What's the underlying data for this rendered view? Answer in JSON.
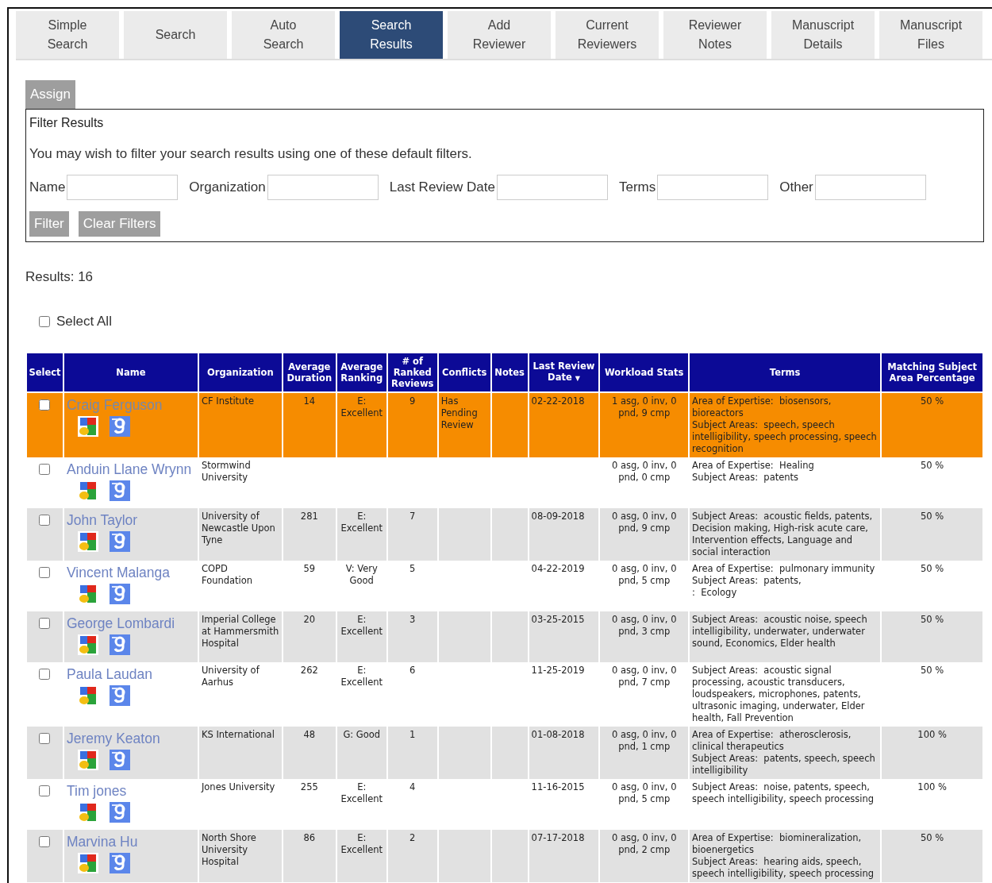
{
  "tabs": [
    {
      "label": "Simple\nSearch",
      "selected": false
    },
    {
      "label": "Search",
      "selected": false
    },
    {
      "label": "Auto\nSearch",
      "selected": false
    },
    {
      "label": "Search\nResults",
      "selected": true
    },
    {
      "label": "Add\nReviewer",
      "selected": false
    },
    {
      "label": "Current\nReviewers",
      "selected": false
    },
    {
      "label": "Reviewer\nNotes",
      "selected": false
    },
    {
      "label": "Manuscript\nDetails",
      "selected": false
    },
    {
      "label": "Manuscript\nFiles",
      "selected": false
    }
  ],
  "assign_button": "Assign",
  "filter": {
    "title": "Filter Results",
    "description": "You may wish to filter your search results using one of these default filters.",
    "fields": [
      {
        "label": "Name"
      },
      {
        "label": "Organization"
      },
      {
        "label": "Last Review Date"
      },
      {
        "label": "Terms"
      },
      {
        "label": "Other"
      }
    ],
    "buttons": [
      "Filter",
      "Clear Filters"
    ]
  },
  "results_count": "Results: 16",
  "select_all": {
    "label": "Select All",
    "checked": false
  },
  "table": {
    "columns": [
      {
        "label": "Select"
      },
      {
        "label": "Name"
      },
      {
        "label": "Organization"
      },
      {
        "label": "Average Duration"
      },
      {
        "label": "Average Ranking"
      },
      {
        "label": "# of Ranked Reviews"
      },
      {
        "label": "Conflicts"
      },
      {
        "label": "Notes"
      },
      {
        "label": "Last Review Date",
        "sort_indicator": "▼"
      },
      {
        "label": "Workload Stats"
      },
      {
        "label": "Terms"
      },
      {
        "label": "Matching Subject Area Percentage"
      }
    ],
    "rows": [
      {
        "checked": false,
        "highlighted": true,
        "name": "Craig Ferguson",
        "organization": "CF Institute",
        "duration": "14",
        "ranking": "E: Excellent",
        "ranked_reviews": "9",
        "conflicts": "Has Pending Review",
        "last_review": "02-22-2018",
        "workload": "1 asg, 0 inv, 0 pnd, 9 cmp",
        "terms": [
          "Area of Expertise:  biosensors, bioreactors",
          "Subject Areas:  speech, speech intelligibility, speech processing, speech recognition"
        ],
        "match": "50 %"
      },
      {
        "checked": false,
        "highlighted": false,
        "name": "Anduin Llane Wrynn",
        "organization": "Stormwind University",
        "workload": "0 asg, 0 inv, 0 pnd, 0 cmp",
        "terms": [
          "Area of Expertise:  Healing",
          "Subject Areas:  patents"
        ],
        "match": "50 %"
      },
      {
        "checked": false,
        "highlighted": false,
        "name": "John Taylor",
        "organization": "University of Newcastle Upon Tyne",
        "duration": "281",
        "ranking": "E: Excellent",
        "ranked_reviews": "7",
        "last_review": "08-09-2018",
        "workload": "0 asg, 0 inv, 0 pnd, 9 cmp",
        "terms": [
          "Subject Areas:  acoustic fields, patents, Decision making, High-risk acute care, Intervention effects, Language and social interaction"
        ],
        "match": "50 %"
      },
      {
        "checked": false,
        "highlighted": false,
        "name": "Vincent Malanga",
        "organization": "COPD Foundation",
        "duration": "59",
        "ranking": "V: Very Good",
        "ranked_reviews": "5",
        "last_review": "04-22-2019",
        "workload": "0 asg, 0 inv, 0 pnd, 5 cmp",
        "terms": [
          "Area of Expertise:  pulmonary immunity",
          "Subject Areas:  patents,",
          ":  Ecology"
        ],
        "match": "50 %"
      },
      {
        "checked": false,
        "highlighted": false,
        "name": "George Lombardi",
        "organization": "Imperial College at Hammersmith Hospital",
        "duration": "20",
        "ranking": "E: Excellent",
        "ranked_reviews": "3",
        "last_review": "03-25-2015",
        "workload": "0 asg, 0 inv, 0 pnd, 3 cmp",
        "terms": [
          "Subject Areas:  acoustic noise, speech intelligibility, underwater, underwater sound, Economics, Elder health"
        ],
        "match": "50 %"
      },
      {
        "checked": false,
        "highlighted": false,
        "name": "Paula Laudan",
        "organization": "University of Aarhus",
        "duration": "262",
        "ranking": "E: Excellent",
        "ranked_reviews": "6",
        "last_review": "11-25-2019",
        "workload": "0 asg, 0 inv, 0 pnd, 7 cmp",
        "terms": [
          "Subject Areas:  acoustic signal processing, acoustic transducers, loudspeakers, microphones, patents, ultrasonic imaging, underwater, Elder health, Fall Prevention"
        ],
        "match": "50 %"
      },
      {
        "checked": false,
        "highlighted": false,
        "name": "Jeremy Keaton",
        "organization": "KS International",
        "duration": "48",
        "ranking": "G: Good",
        "ranked_reviews": "1",
        "last_review": "01-08-2018",
        "workload": "0 asg, 0 inv, 0 pnd, 1 cmp",
        "terms": [
          "Area of Expertise:  atherosclerosis, clinical therapeutics",
          "Subject Areas:  patents, speech, speech intelligibility"
        ],
        "match": "100 %"
      },
      {
        "checked": false,
        "highlighted": false,
        "name": "Tim jones",
        "organization": "Jones University",
        "duration": "255",
        "ranking": "E: Excellent",
        "ranked_reviews": "4",
        "last_review": "11-16-2015",
        "workload": "0 asg, 0 inv, 0 pnd, 5 cmp",
        "terms": [
          "Subject Areas:  noise, patents, speech, speech intelligibility, speech processing"
        ],
        "match": "100 %"
      },
      {
        "checked": false,
        "highlighted": false,
        "name": "Marvina Hu",
        "organization": "North Shore University Hospital",
        "duration": "86",
        "ranking": "E: Excellent",
        "ranked_reviews": "2",
        "last_review": "07-17-2018",
        "workload": "0 asg, 0 inv, 0 pnd, 2 cmp",
        "terms": [
          "Area of Expertise:  biomineralization, bioenergetics",
          "Subject Areas:  hearing aids, speech, speech intelligibility, speech processing"
        ],
        "match": "50 %"
      }
    ]
  }
}
